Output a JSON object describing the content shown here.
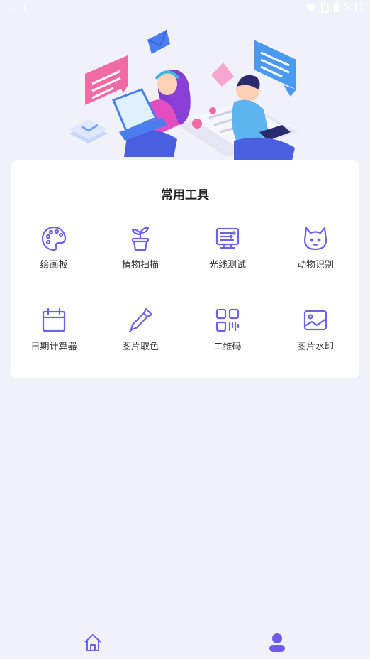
{
  "status_bar": {
    "time": "5:11",
    "icons": [
      "download-icon",
      "download-icon",
      "wifi-icon",
      "no-sim-icon",
      "battery-icon"
    ]
  },
  "card": {
    "title": "常用工具",
    "tools": [
      {
        "label": "绘画板",
        "icon": "palette-icon"
      },
      {
        "label": "植物扫描",
        "icon": "plant-pot-icon"
      },
      {
        "label": "光线测试",
        "icon": "light-meter-icon"
      },
      {
        "label": "动物识别",
        "icon": "cat-face-icon"
      },
      {
        "label": "日期计算器",
        "icon": "calendar-icon"
      },
      {
        "label": "图片取色",
        "icon": "eyedropper-icon"
      },
      {
        "label": "二维码",
        "icon": "qr-code-icon"
      },
      {
        "label": "图片水印",
        "icon": "image-icon"
      }
    ]
  },
  "tab_bar": {
    "tabs": [
      {
        "icon": "home-icon"
      },
      {
        "icon": "user-icon"
      }
    ]
  },
  "colors": {
    "accent": "#6c5ce7",
    "icon_stroke": "#6b63e6",
    "background": "#f1f1f9",
    "card": "#ffffff"
  }
}
